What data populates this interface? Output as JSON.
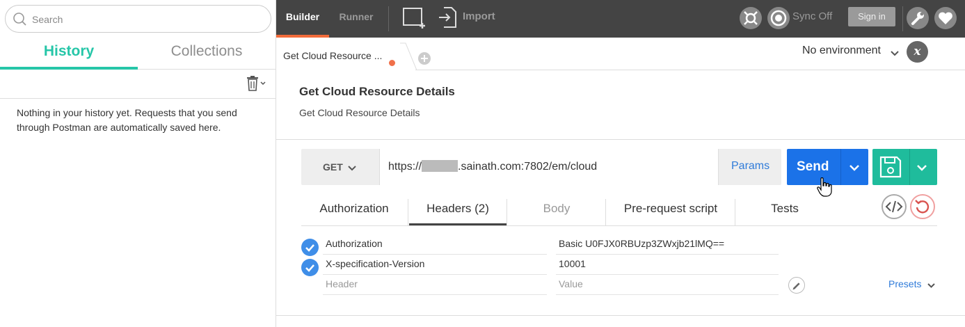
{
  "sidebar": {
    "search_placeholder": "Search",
    "tabs": [
      {
        "label": "History"
      },
      {
        "label": "Collections"
      }
    ],
    "empty_message": "Nothing in your history yet. Requests that you send through Postman are automatically saved here."
  },
  "header": {
    "builder": "Builder",
    "runner": "Runner",
    "import": "Import",
    "sync": "Sync Off",
    "signin": "Sign in"
  },
  "tabstrip": {
    "tab_label": "Get Cloud Resource ...",
    "environment": "No environment",
    "env_quick_look": "x"
  },
  "request": {
    "title": "Get Cloud Resource Details",
    "description": "Get Cloud Resource Details",
    "method": "GET",
    "url_prefix": "https://",
    "url_suffix": ".sainath.com:7802/em/cloud",
    "params": "Params",
    "send": "Send",
    "tabs": [
      {
        "label": "Authorization"
      },
      {
        "label": "Headers (2)"
      },
      {
        "label": "Body"
      },
      {
        "label": "Pre-request script"
      },
      {
        "label": "Tests"
      }
    ],
    "headers": [
      {
        "key": "Authorization",
        "value": "Basic U0FJX0RBUzp3ZWxjb21lMQ=="
      },
      {
        "key": "X-specification-Version",
        "value": "10001"
      }
    ],
    "key_placeholder": "Header",
    "value_placeholder": "Value",
    "presets": "Presets"
  },
  "colors": {
    "accent_teal": "#26c6a8",
    "builder_underline": "#f26b3a",
    "send_blue": "#1b72e8",
    "save_green": "#1fbc9c",
    "link_blue": "#2f7bd9"
  }
}
